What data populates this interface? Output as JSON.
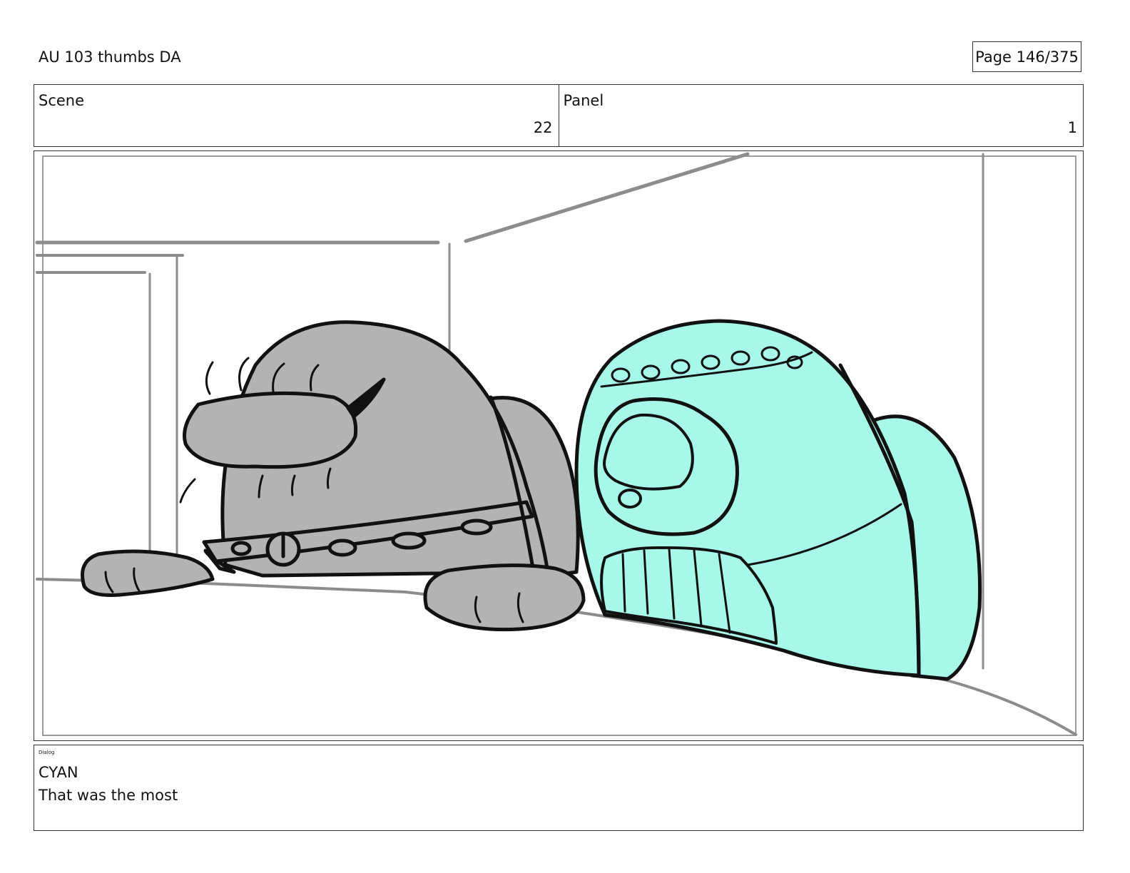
{
  "header": {
    "title": "AU 103 thumbs DA",
    "page_indicator": "Page 146/375"
  },
  "info": {
    "scene_label": "Scene",
    "scene_value": "22",
    "panel_label": "Panel",
    "panel_value": "1"
  },
  "dialog": {
    "label": "Dialog",
    "speaker": "CYAN",
    "line": "That was the most"
  },
  "colors": {
    "gray_character": "#b3b3b3",
    "cyan_character": "#a8f8ea",
    "outline": "#111111",
    "background_lines": "#8c8c8c"
  }
}
